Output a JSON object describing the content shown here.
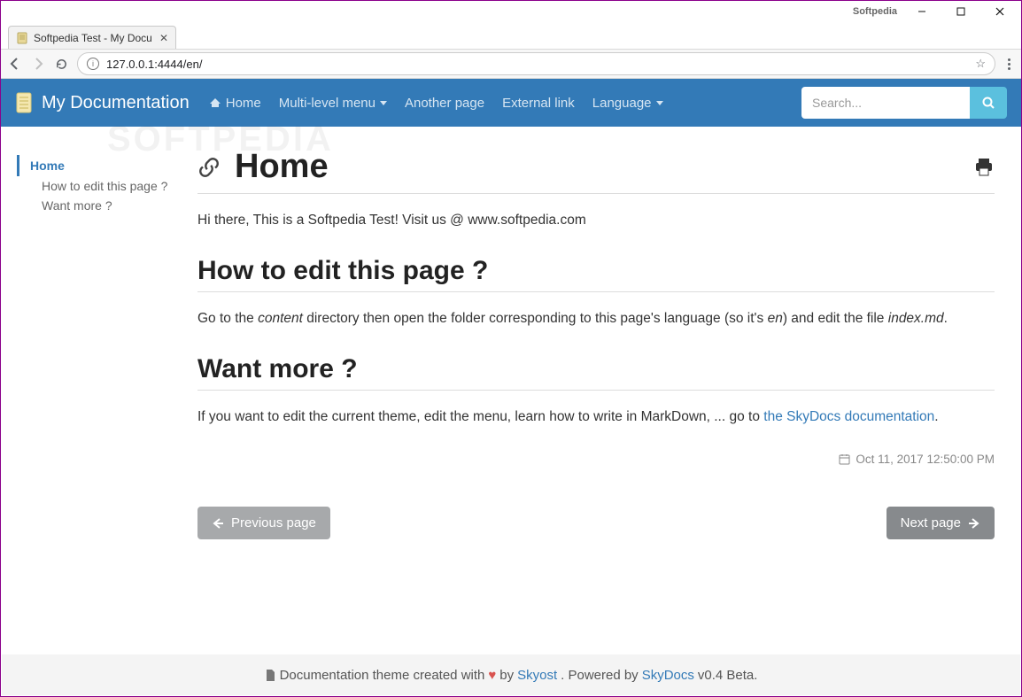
{
  "window": {
    "label": "Softpedia"
  },
  "tab": {
    "title": "Softpedia Test - My Docu"
  },
  "address": {
    "url": "127.0.0.1:4444/en/"
  },
  "navbar": {
    "brand": "My Documentation",
    "items": [
      "Home",
      "Multi-level menu",
      "Another page",
      "External link",
      "Language"
    ],
    "search_placeholder": "Search..."
  },
  "sidebar": {
    "active": "Home",
    "subs": [
      "How to edit this page ?",
      "Want more ?"
    ]
  },
  "content": {
    "h1": "Home",
    "intro": "Hi there, This is a Softpedia Test! Visit us @ www.softpedia.com",
    "h2a": "How to edit this page ?",
    "p2_a": "Go to the ",
    "p2_em1": "content",
    "p2_b": " directory then open the folder corresponding to this page's language (so it's ",
    "p2_em2": "en",
    "p2_c": ") and edit the file ",
    "p2_em3": "index.md",
    "p2_d": ".",
    "h2b": "Want more ?",
    "p3_a": "If you want to edit the current theme, edit the menu, learn how to write in MarkDown, ... go to ",
    "p3_link": "the SkyDocs documentation",
    "p3_b": ".",
    "timestamp": "Oct 11, 2017 12:50:00 PM",
    "prev": "Previous page",
    "next": "Next page"
  },
  "footer": {
    "a": "Documentation theme created with",
    "b": "by",
    "author": "Skyost",
    "c": ". Powered by ",
    "powered": "SkyDocs",
    "d": " v0.4 Beta."
  },
  "watermark": "SOFTPEDIA"
}
